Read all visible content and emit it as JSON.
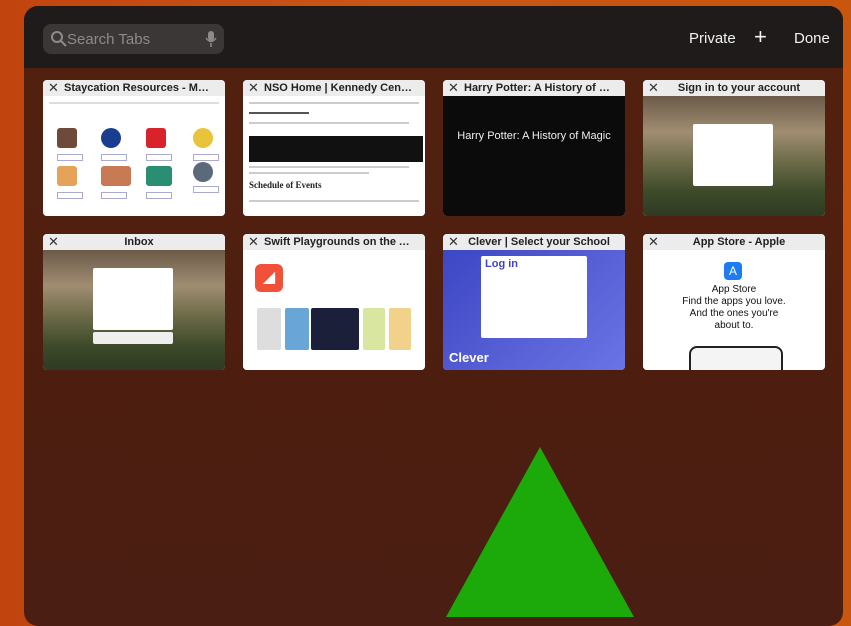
{
  "search": {
    "placeholder": "Search Tabs"
  },
  "toolbar": {
    "private_label": "Private",
    "new_tab_label": "+",
    "done_label": "Done"
  },
  "tabs": [
    {
      "title": "Staycation Resources - Mounta..."
    },
    {
      "title": "NSO Home | Kennedy Center",
      "heading": "Schedule of Events"
    },
    {
      "title": "Harry Potter: A History of Magi...",
      "headline": "Harry Potter: A History of Magic"
    },
    {
      "title": "Sign in to your account"
    },
    {
      "title": "Inbox"
    },
    {
      "title": "Swift Playgrounds on the App S..."
    },
    {
      "title": "Clever | Select your School",
      "login_text": "Log in",
      "brand": "Clever"
    },
    {
      "title": "App Store - Apple",
      "headline": "App Store\nFind the apps you love.\nAnd the ones you're\nabout to."
    }
  ],
  "colors": {
    "triangle": "#1caa0b",
    "background": "#c8560f",
    "overlay": "#4b1e12"
  },
  "icons": [
    "search-icon",
    "microphone-icon",
    "close-icon",
    "plus-icon"
  ]
}
